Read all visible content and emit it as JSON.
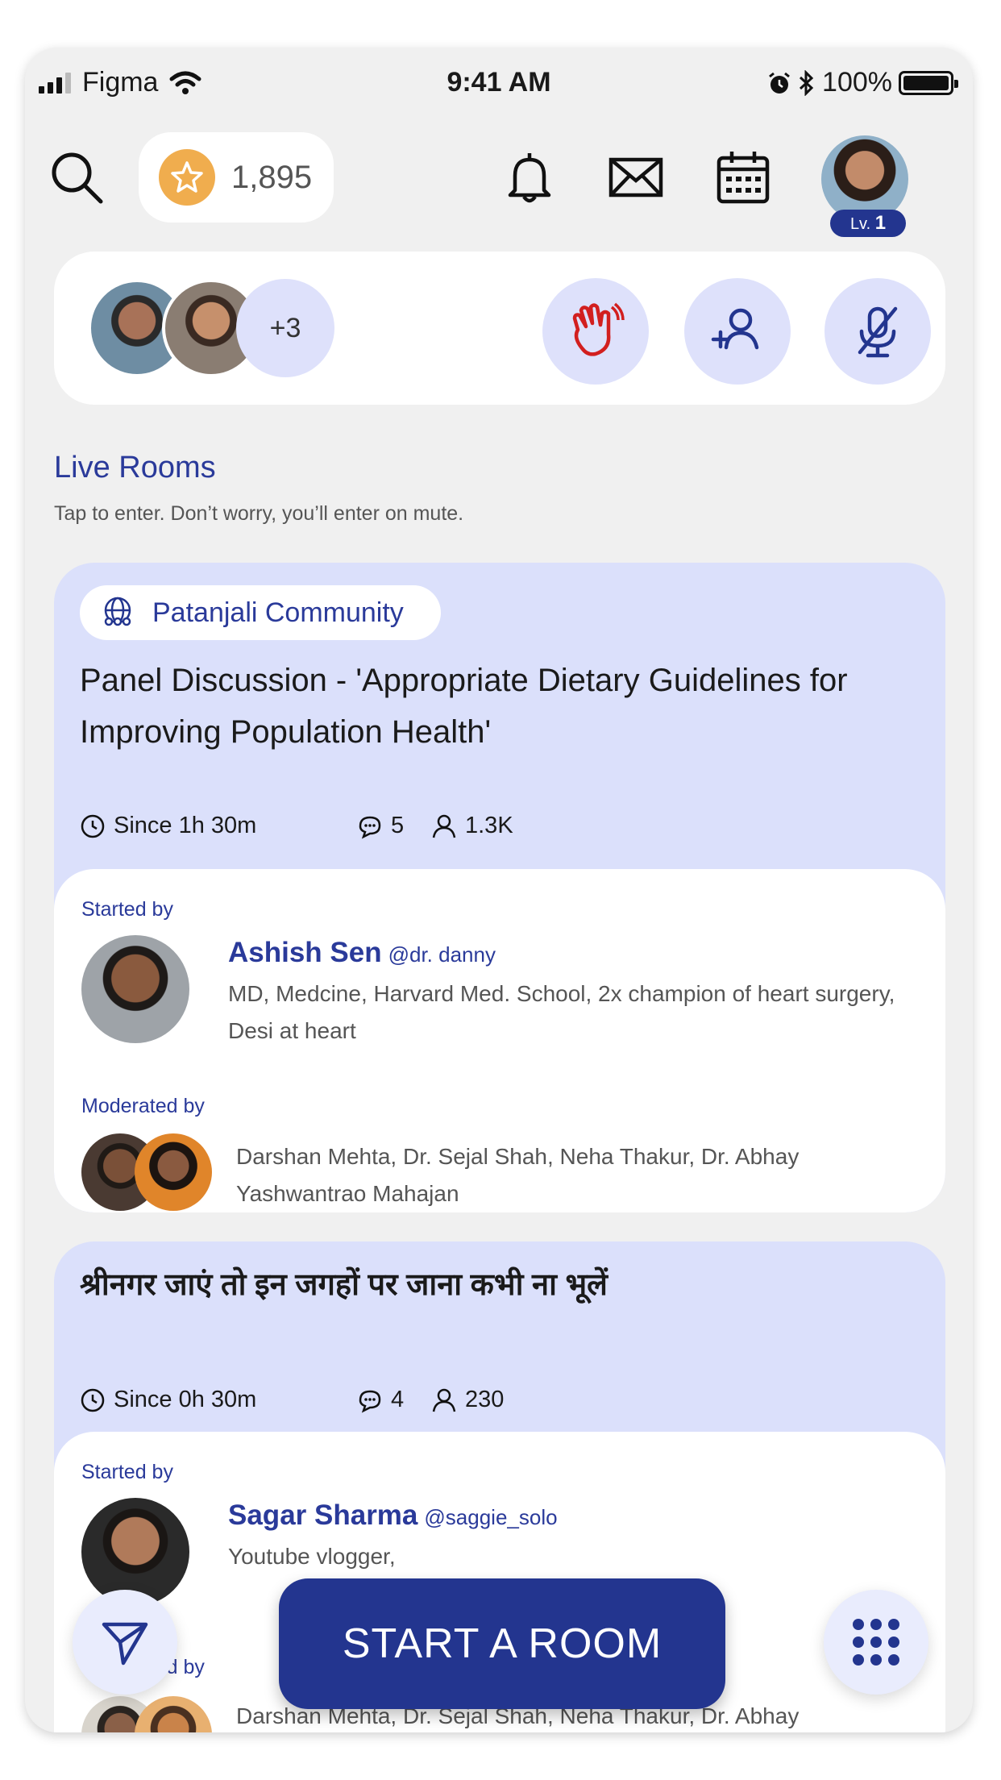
{
  "status_bar": {
    "carrier": "Figma",
    "time": "9:41 AM",
    "battery": "100%"
  },
  "header": {
    "points": "1,895",
    "level_prefix": "Lv.",
    "level": "1"
  },
  "participants": {
    "extra_count": "+3"
  },
  "live_rooms": {
    "title": "Live Rooms",
    "subtitle": "Tap to enter. Don’t worry, you’ll enter on mute."
  },
  "rooms": [
    {
      "community": "Patanjali Community",
      "title": "Panel Discussion - 'Appropriate Dietary Guidelines for Improving Population Health'",
      "since": "Since 1h 30m",
      "comments": "5",
      "listeners": "1.3K",
      "started_label": "Started by",
      "starter_name": "Ashish Sen",
      "starter_handle": "@dr. danny",
      "starter_bio": "MD, Medcine, Harvard Med. School, 2x champion of heart surgery, Desi at heart",
      "moderated_label": "Moderated by",
      "moderators": "Darshan Mehta, Dr. Sejal Shah, Neha Thakur, Dr. Abhay Yashwantrao Mahajan"
    },
    {
      "title": "श्रीनगर जाएं तो इन जगहों पर जाना कभी ना भूलें",
      "since": "Since 0h 30m",
      "comments": "4",
      "listeners": "230",
      "started_label": "Started by",
      "starter_name": "Sagar Sharma",
      "starter_handle": "@saggie_solo",
      "starter_bio": "Youtube vlogger,",
      "moderated_label": "Moderated by",
      "moderators": "Darshan Mehta, Dr. Sejal Shah, Neha Thakur, Dr. Abhay Yashwantrao Mahajan"
    }
  ],
  "actions": {
    "start_room": "START A ROOM"
  },
  "colors": {
    "accent": "#23358f",
    "card_bg": "#dbe0fb",
    "wave_red": "#d21f1f",
    "coin": "#f0ad4e"
  }
}
